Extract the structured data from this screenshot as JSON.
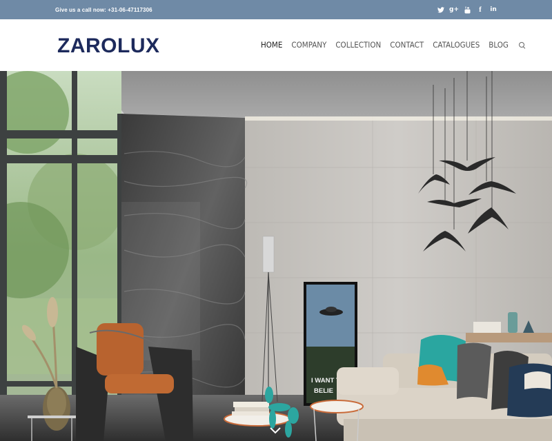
{
  "topbar": {
    "phone_text": "Give us a call now: +31-06-47117306",
    "social": [
      {
        "icon": "twitter-icon",
        "glyph": "t"
      },
      {
        "icon": "google-plus-icon",
        "glyph": "g+"
      },
      {
        "icon": "youtube-icon",
        "glyph": "▶"
      },
      {
        "icon": "facebook-icon",
        "glyph": "f"
      },
      {
        "icon": "linkedin-icon",
        "glyph": "in"
      }
    ]
  },
  "header": {
    "logo": "ZAROLUX",
    "nav": [
      {
        "label": "HOME",
        "active": true
      },
      {
        "label": "COMPANY",
        "active": false
      },
      {
        "label": "COLLECTION",
        "active": false
      },
      {
        "label": "CONTACT",
        "active": false
      },
      {
        "label": "CATALOGUES",
        "active": false
      },
      {
        "label": "BLOG",
        "active": false
      }
    ]
  },
  "hero": {
    "poster_text_line1": "I WANT TO",
    "poster_text_line2": "BELIE"
  },
  "colors": {
    "topbar_bg": "#6f8aa6",
    "logo": "#1d2a5c",
    "wall": "#c8c6c2",
    "marble": "#4a4a4a",
    "sofa": "#d9d2c6",
    "chair_leather": "#c06a33"
  }
}
